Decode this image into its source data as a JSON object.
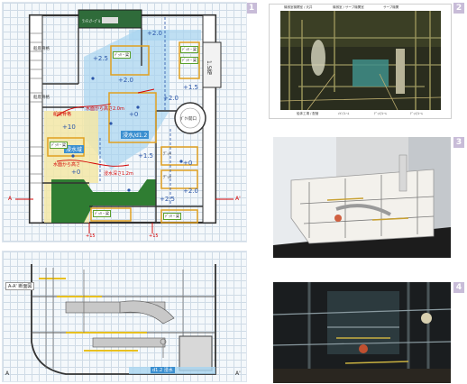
{
  "figures": [
    {
      "number": "1"
    },
    {
      "number": "2"
    },
    {
      "number": "3"
    },
    {
      "number": "4"
    }
  ],
  "plan": {
    "room_labels": [
      "船底骨格",
      "船底骨格",
      "ﾗﾝﾁｭﾃｰﾌﾞﾙ",
      "ﾃﾞｯｷ",
      "ﾃﾞｯｷ"
    ],
    "stair_label": "1.5階",
    "tank_label": "ﾀﾞｸﾄ開口",
    "water_label": "浸水/d1.2",
    "water2_label": "浸水域",
    "levels": [
      "+2.0",
      "+2.5",
      "+2.0",
      "+1.5",
      "+10",
      "+2.0",
      "+1.5",
      "+0",
      "+2.5",
      "+2.0",
      "+0",
      "+0"
    ],
    "small_labels": [
      "ﾃﾞｯｷ・梁",
      "ﾃﾞｯｷ・梁",
      "ﾃﾞｯｷ・梁",
      "ﾃﾞｯｷ・梁",
      "ﾃﾞｯｷ・梁",
      "ﾃﾞｯｷ・梁"
    ],
    "red_notes": [
      "水面から高さ2.0m",
      "船底骨格",
      "水面から高さ",
      "浸水深さ1.2m"
    ],
    "dims": [
      "+15",
      "+15"
    ],
    "section_marks": [
      "A",
      "A'"
    ]
  },
  "section": {
    "caption": "A-A' 断面図",
    "bottom_label": "d1.2 浸水",
    "marks": [
      "A",
      "A'"
    ]
  },
  "render": {
    "header_labels": [
      "機械室機関室 / 天井",
      "機械室 / サーブ機関室",
      "サーブ機関"
    ],
    "footer_labels": [
      "船体工場 / 配管",
      "ﾒｲﾝﾌﾚｰﾑ",
      "ﾃﾞｯｷﾌﾚｰﾑ",
      "ﾃﾞｯｷﾌﾚｰﾑ"
    ]
  },
  "colors": {
    "badge": "#c8bcd8",
    "water": "#a8d4f0",
    "yellow": "#f3e7a6",
    "green": "#2f7d32",
    "orange": "#e0a020",
    "red": "#d40000"
  }
}
